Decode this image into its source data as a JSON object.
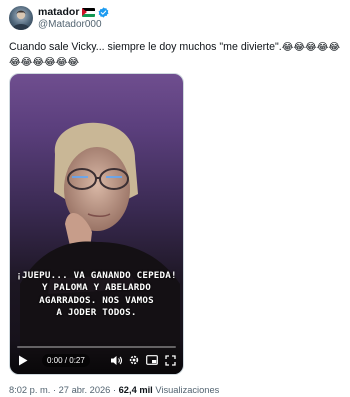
{
  "author": {
    "name": "matador",
    "handle": "@Matador000",
    "avatar_icon": "profile-photo",
    "flag_icon": "palestine-flag",
    "verified_icon": "verified-badge-icon",
    "verified_color": "#1d9bf0"
  },
  "tweet": {
    "text": "Cuando sale Vicky... siempre le doy muchos \"me divierte\".",
    "emoji_line1": "😂😂😂😂😂",
    "emoji_line2": "😂😂😂😂😂😂"
  },
  "video": {
    "caption_lines": [
      "¡JUEPU... VA GANANDO CEPEDA!",
      "Y PALOMA Y ABELARDO",
      "AGARRADOS. NOS VAMOS",
      "A JODER TODOS."
    ],
    "time": "0:00 / 0:27",
    "progress": 0,
    "controls": [
      "play-icon",
      "volume-icon",
      "gear-icon",
      "picture-in-picture-icon",
      "fullscreen-icon"
    ],
    "accent": "#1d9bf0"
  },
  "meta": {
    "time": "8:02 p. m.",
    "separator": "·",
    "date": "27 abr. 2026",
    "views_count": "62,4 mil",
    "views_label": "Visualizaciones"
  }
}
